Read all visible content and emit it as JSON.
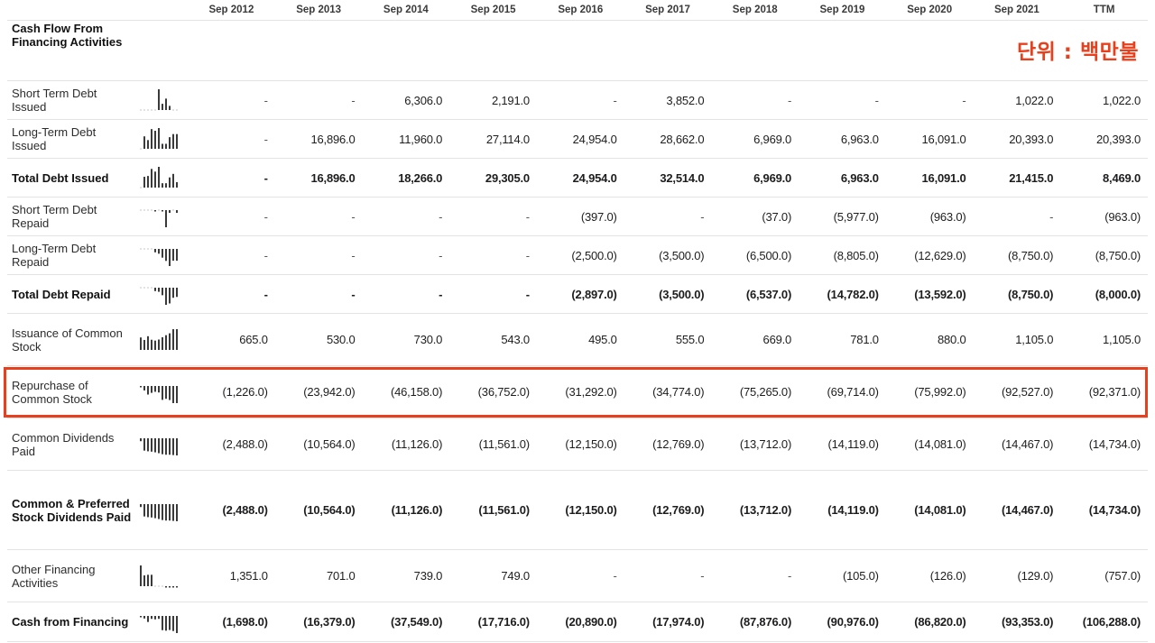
{
  "unit_label": "단위 : 백만불",
  "columns": [
    "Sep 2012",
    "Sep 2013",
    "Sep 2014",
    "Sep 2015",
    "Sep 2016",
    "Sep 2017",
    "Sep 2018",
    "Sep 2019",
    "Sep 2020",
    "Sep 2021",
    "TTM"
  ],
  "section_title": "Cash Flow From Financing Activities",
  "highlighted_row": "Repurchase of Common Stock",
  "highlight_color": "#e8401c",
  "rows": [
    {
      "label": "Short Term Debt Issued",
      "bold": false,
      "spark": [
        0,
        0,
        0,
        0,
        0,
        1,
        0.3,
        0.55,
        0.2,
        0,
        0
      ],
      "values": [
        "-",
        "-",
        "6,306.0",
        "2,191.0",
        "-",
        "3,852.0",
        "-",
        "-",
        "-",
        "1,022.0",
        "1,022.0"
      ]
    },
    {
      "label": "Long-Term Debt Issued",
      "bold": false,
      "spark": [
        0,
        0.6,
        0.42,
        0.95,
        0.87,
        1,
        0.24,
        0.24,
        0.56,
        0.71,
        0.71
      ],
      "values": [
        "-",
        "16,896.0",
        "11,960.0",
        "27,114.0",
        "24,954.0",
        "28,662.0",
        "6,969.0",
        "6,963.0",
        "16,091.0",
        "20,393.0",
        "20,393.0"
      ]
    },
    {
      "label": "Total Debt Issued",
      "bold": true,
      "spark": [
        0,
        0.52,
        0.56,
        0.9,
        0.77,
        1,
        0.21,
        0.21,
        0.49,
        0.66,
        0.26
      ],
      "values": [
        "-",
        "16,896.0",
        "18,266.0",
        "29,305.0",
        "24,954.0",
        "32,514.0",
        "6,969.0",
        "6,963.0",
        "16,091.0",
        "21,415.0",
        "8,469.0"
      ]
    },
    {
      "label": "Short Term Debt Repaid",
      "bold": false,
      "spark": [
        0,
        0,
        0,
        0,
        -0.07,
        0,
        -0.01,
        -1,
        -0.16,
        0,
        -0.16
      ],
      "values": [
        "-",
        "-",
        "-",
        "-",
        "(397.0)",
        "-",
        "(37.0)",
        "(5,977.0)",
        "(963.0)",
        "-",
        "(963.0)"
      ]
    },
    {
      "label": "Long-Term Debt Repaid",
      "bold": false,
      "spark": [
        0,
        0,
        0,
        0,
        -0.2,
        -0.28,
        -0.51,
        -0.7,
        -1,
        -0.69,
        -0.69
      ],
      "values": [
        "-",
        "-",
        "-",
        "-",
        "(2,500.0)",
        "(3,500.0)",
        "(6,500.0)",
        "(8,805.0)",
        "(12,629.0)",
        "(8,750.0)",
        "(8,750.0)"
      ]
    },
    {
      "label": "Total Debt Repaid",
      "bold": true,
      "spark": [
        0,
        0,
        0,
        0,
        -0.2,
        -0.24,
        -0.44,
        -1,
        -0.92,
        -0.59,
        -0.54
      ],
      "values": [
        "-",
        "-",
        "-",
        "-",
        "(2,897.0)",
        "(3,500.0)",
        "(6,537.0)",
        "(14,782.0)",
        "(13,592.0)",
        "(8,750.0)",
        "(8,000.0)"
      ]
    },
    {
      "label": "Issuance of Common Stock",
      "bold": false,
      "spark": [
        0.6,
        0.48,
        0.66,
        0.49,
        0.45,
        0.5,
        0.61,
        0.71,
        0.8,
        1,
        1
      ],
      "values": [
        "665.0",
        "530.0",
        "730.0",
        "543.0",
        "495.0",
        "555.0",
        "669.0",
        "781.0",
        "880.0",
        "1,105.0",
        "1,105.0"
      ]
    },
    {
      "label": "Repurchase of Common Stock",
      "bold": false,
      "spark": [
        -0.01,
        -0.26,
        -0.5,
        -0.4,
        -0.34,
        -0.38,
        -0.81,
        -0.75,
        -0.82,
        -1,
        -1
      ],
      "values": [
        "(1,226.0)",
        "(23,942.0)",
        "(46,158.0)",
        "(36,752.0)",
        "(31,292.0)",
        "(34,774.0)",
        "(75,265.0)",
        "(69,714.0)",
        "(75,992.0)",
        "(92,527.0)",
        "(92,371.0)"
      ]
    },
    {
      "label": "Common Dividends Paid",
      "bold": false,
      "spark": [
        -0.17,
        -0.72,
        -0.76,
        -0.78,
        -0.82,
        -0.87,
        -0.93,
        -0.96,
        -0.96,
        -0.98,
        -1
      ],
      "values": [
        "(2,488.0)",
        "(10,564.0)",
        "(11,126.0)",
        "(11,561.0)",
        "(12,150.0)",
        "(12,769.0)",
        "(13,712.0)",
        "(14,119.0)",
        "(14,081.0)",
        "(14,467.0)",
        "(14,734.0)"
      ]
    },
    {
      "label": "Common & Preferred Stock Dividends Paid",
      "bold": true,
      "spark": [
        -0.17,
        -0.72,
        -0.76,
        -0.78,
        -0.82,
        -0.87,
        -0.93,
        -0.96,
        -0.96,
        -0.98,
        -1
      ],
      "values": [
        "(2,488.0)",
        "(10,564.0)",
        "(11,126.0)",
        "(11,561.0)",
        "(12,150.0)",
        "(12,769.0)",
        "(13,712.0)",
        "(14,119.0)",
        "(14,081.0)",
        "(14,467.0)",
        "(14,734.0)"
      ]
    },
    {
      "label": "Other Financing Activities",
      "bold": false,
      "spark": [
        1,
        0.52,
        0.55,
        0.55,
        0,
        0,
        0,
        -0.08,
        -0.09,
        -0.1,
        -0.56
      ],
      "values": [
        "1,351.0",
        "701.0",
        "739.0",
        "749.0",
        "-",
        "-",
        "-",
        "(105.0)",
        "(126.0)",
        "(129.0)",
        "(757.0)"
      ]
    },
    {
      "label": "Cash from Financing",
      "bold": true,
      "spark": [
        -0.02,
        -0.15,
        -0.35,
        -0.17,
        -0.2,
        -0.17,
        -0.83,
        -0.86,
        -0.82,
        -0.88,
        -1
      ],
      "values": [
        "(1,698.0)",
        "(16,379.0)",
        "(37,549.0)",
        "(17,716.0)",
        "(20,890.0)",
        "(17,974.0)",
        "(87,876.0)",
        "(90,976.0)",
        "(86,820.0)",
        "(93,353.0)",
        "(106,288.0)"
      ]
    }
  ]
}
